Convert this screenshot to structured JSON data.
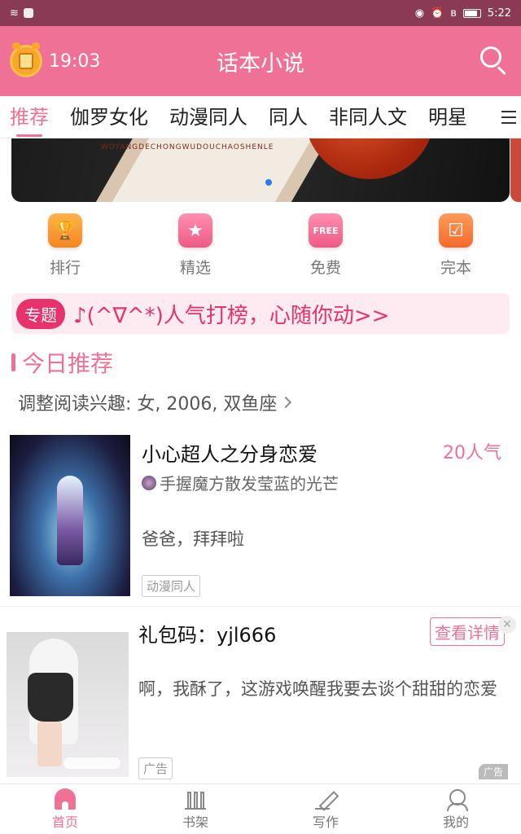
{
  "status_bar": {
    "time": "5:22"
  },
  "header": {
    "time": "19:03",
    "title": "话本小说"
  },
  "tabs": [
    "推荐",
    "伽罗女化",
    "动漫同人",
    "同人",
    "非同人文",
    "明星"
  ],
  "banner": {
    "text": "WOYANGDECHONGWUDOUCHAOSHENLE"
  },
  "quick_nav": [
    {
      "label": "排行",
      "icon": "trophy-icon"
    },
    {
      "label": "精选",
      "icon": "star-icon"
    },
    {
      "label": "免费",
      "icon": "free-icon",
      "icon_text": "FREE"
    },
    {
      "label": "完本",
      "icon": "check-icon"
    }
  ],
  "topic": {
    "tag": "专题",
    "text": "♪(^∇^*)人气打榜，心随你动>>"
  },
  "section": {
    "title": "今日推荐"
  },
  "interest": {
    "text": "调整阅读兴趣: 女, 2006, 双鱼座"
  },
  "book": {
    "title": "小心超人之分身恋爱",
    "popularity": "20人气",
    "author": "手握魔方散发莹蓝的光芒",
    "desc": "爸爸，拜拜啦",
    "tag": "动漫同人"
  },
  "ad": {
    "title": "礼包码：yjl666",
    "button": "查看详情",
    "desc": "啊，我酥了，这游戏唤醒我要去谈个甜甜的恋爱",
    "tag": "广告",
    "mark": "广告"
  },
  "bottom_nav": [
    {
      "label": "首页",
      "active": true
    },
    {
      "label": "书架"
    },
    {
      "label": "写作"
    },
    {
      "label": "我的"
    }
  ],
  "colors": {
    "brand": "#ef7196",
    "status_bar": "#8b3a55",
    "topic_accent": "#e8326b"
  }
}
